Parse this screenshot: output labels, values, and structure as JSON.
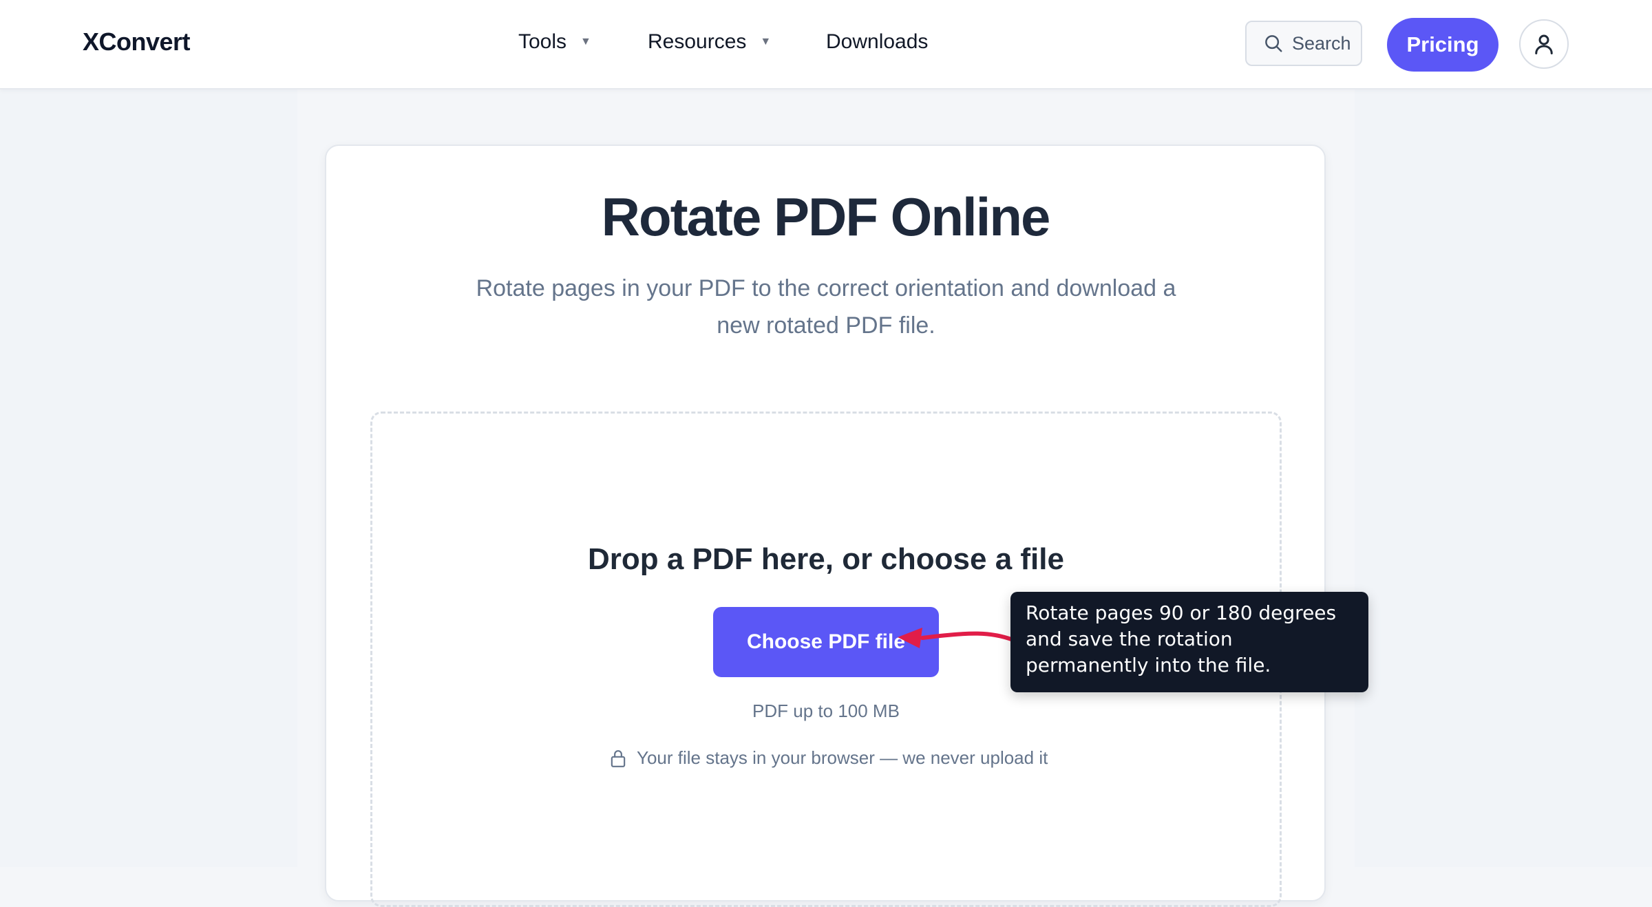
{
  "header": {
    "logo": "XConvert",
    "nav": [
      {
        "label": "Tools",
        "caret": "▼"
      },
      {
        "label": "Resources",
        "caret": "▼"
      },
      {
        "label": "Downloads"
      }
    ],
    "search_label": "Search",
    "pricing_label": "Pricing",
    "icons": {
      "search": "search-icon",
      "avatar": "user-icon",
      "caret": "chevron-down-icon"
    }
  },
  "main": {
    "title": "Rotate PDF Online",
    "subtitle": "Rotate pages in your PDF to the correct orientation and download a new rotated PDF file.",
    "dropzone": {
      "title": "Drop a PDF here, or choose a file",
      "button_label": "Choose PDF file",
      "hint": "PDF up to 100 MB",
      "privacy": "Your file stays in your browser — we never upload it",
      "privacy_icon": "lock-icon"
    },
    "tooltip": "Rotate pages 90 or 180 degrees and save the rotation permanently into the file."
  },
  "colors": {
    "accent": "#5b57f6",
    "annotation_arrow": "#e11d48",
    "tooltip_bg": "#111827",
    "page_bg": "#f4f6f9"
  }
}
